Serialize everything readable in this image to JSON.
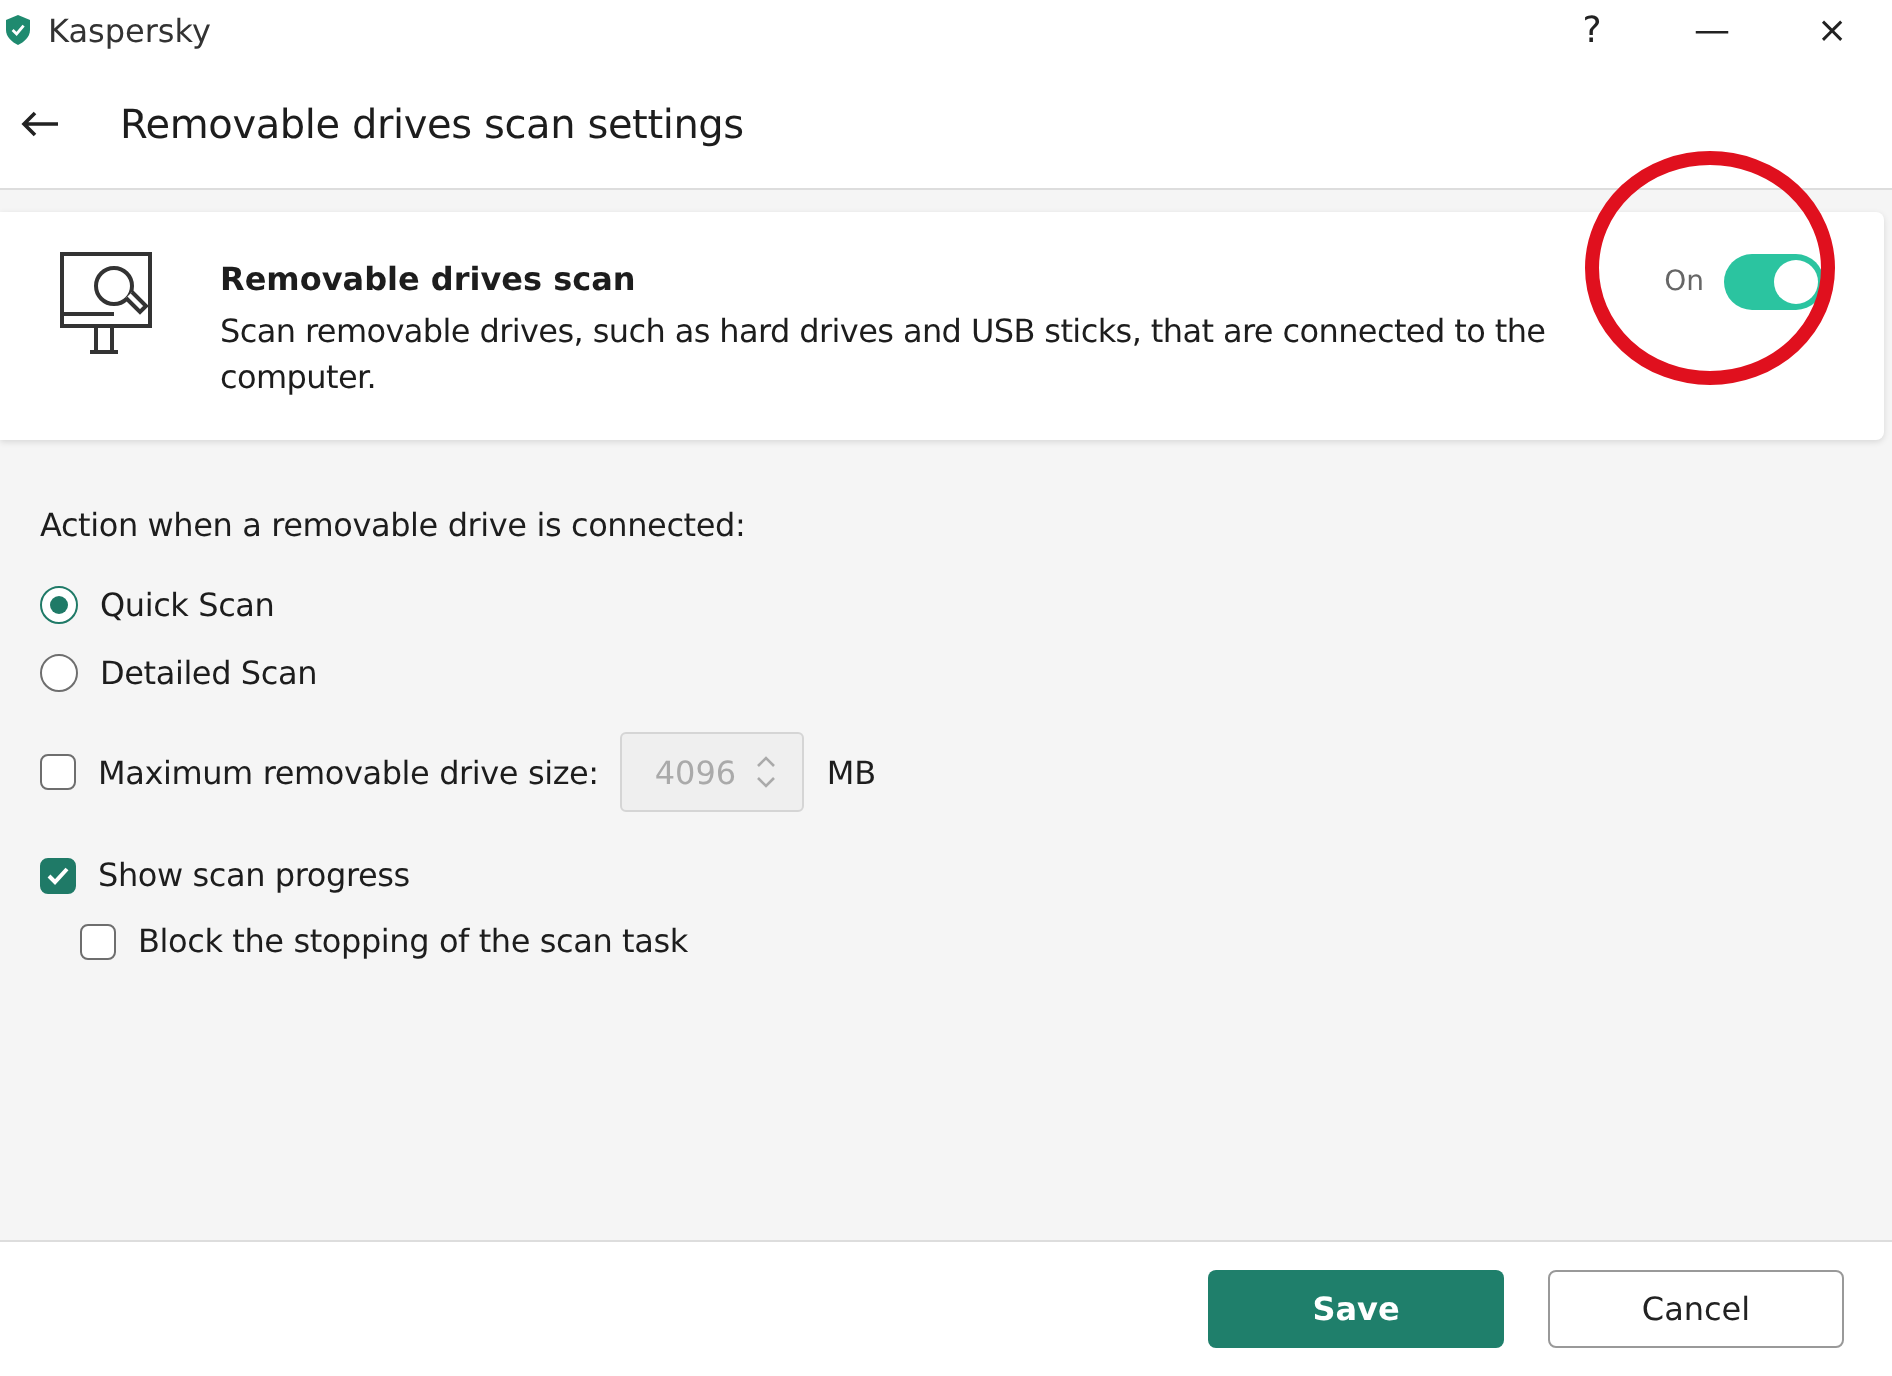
{
  "window": {
    "title": "Kaspersky",
    "controls": [
      "?",
      "—",
      "×"
    ]
  },
  "header": {
    "title": "Removable drives scan settings"
  },
  "feature": {
    "title": "Removable drives scan",
    "description": "Scan removable drives, such as hard drives and USB sticks, that are connected to the computer.",
    "toggle_label": "On",
    "on": true,
    "highlight": {
      "kind": "circle",
      "color": "#e0101e"
    }
  },
  "action_label": "Action when a removable drive is connected:",
  "scan_modes": [
    {
      "label": "Quick Scan",
      "selected": true
    },
    {
      "label": "Detailed Scan",
      "selected": false
    }
  ],
  "options": [
    {
      "kind": "size",
      "label": "Maximum removable drive size:",
      "checked": false,
      "value": "4096",
      "unit": "MB",
      "disabled": true
    },
    {
      "kind": "check",
      "label": "Show scan progress",
      "checked": true,
      "children": [
        {
          "label": "Block the stopping of the scan task",
          "checked": false
        }
      ]
    }
  ],
  "buttons": [
    {
      "label": "Save",
      "kind": "primary"
    },
    {
      "label": "Cancel",
      "kind": "secondary"
    }
  ]
}
